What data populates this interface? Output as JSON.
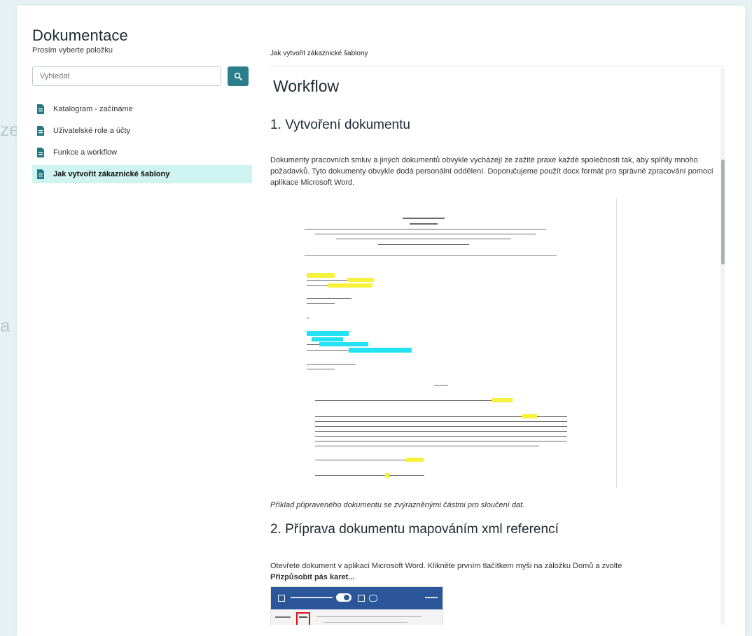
{
  "background_fragments": {
    "left_a": "ze",
    "left_b": "a"
  },
  "sidebar": {
    "title": "Dokumentace",
    "subtitle": "Prosím vyberte položku",
    "search": {
      "placeholder": "Vyhledat",
      "button_icon": "search-icon"
    },
    "items": [
      {
        "label": "Katalogram - začínáme",
        "icon": "document-icon",
        "active": false
      },
      {
        "label": "Uživatelské role a účty",
        "icon": "document-icon",
        "active": false
      },
      {
        "label": "Funkce a workflow",
        "icon": "document-icon",
        "active": false
      },
      {
        "label": "Jak vytvořit zákaznické šablony",
        "icon": "document-icon",
        "active": true
      }
    ]
  },
  "main": {
    "breadcrumb": "Jak vytvořit zákaznické šablony",
    "heading": "Workflow",
    "section1_title": "1. Vytvoření dokumentu",
    "section1_text": "Dokumenty pracovních smluv a jiných dokumentů obvykle vycházejí ze zažité praxe každé společnosti tak, aby splňily mnoho požadavků. Tyto dokumenty obvykle dodá personální oddělení. Doporučujeme použít docx formát pro správné zpracování pomocí aplikace Microsoft Word.",
    "image_caption": "Příklad připraveného dokumentu se zvýrazněnými částmi pro sloučení dat.",
    "section2_title": "2. Příprava dokumentu mapováním xml referencí",
    "section2_text": "Otevřete dokument v aplikaci Microsoft Word. Klikněte prvním tlačítkem myši na záložku Domů a zvolte",
    "section2_bold": "Přizpůsobit pás karet..."
  },
  "colors": {
    "accent": "#2c7d8c",
    "active_item_bg": "#cff3f0",
    "highlight_yellow": "#f6f13a",
    "highlight_cyan": "#23e2f2",
    "ribbon_blue": "#2b579a"
  }
}
